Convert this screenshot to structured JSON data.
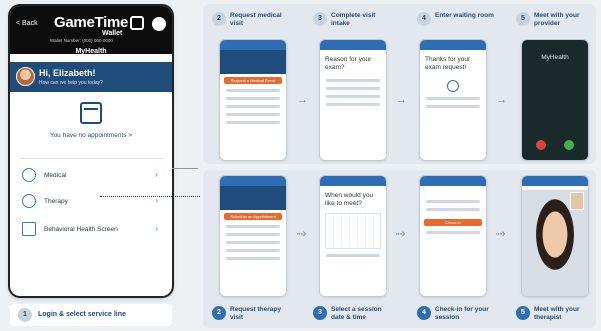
{
  "phone": {
    "back": "< Back",
    "brand": "GameTime",
    "wallet": "Wallet",
    "member": "Wallet Number: (000) 000-0000",
    "section": "MyHealth",
    "greeting": "Hi, Elizabeth!",
    "prompt": "How can we help you today?",
    "appointments": "You have no appointments >",
    "services": [
      {
        "label": "Medical",
        "icon": "stethoscope-icon"
      },
      {
        "label": "Therapy",
        "icon": "therapy-icon"
      },
      {
        "label": "Behavioral Health Screen",
        "icon": "clipboard-icon"
      }
    ]
  },
  "login_step": {
    "num": "1",
    "text": "Login & select service line"
  },
  "top_steps": [
    {
      "num": "2",
      "text": "Request medical visit"
    },
    {
      "num": "3",
      "text": "Complete visit intake"
    },
    {
      "num": "4",
      "text": "Enter waiting room"
    },
    {
      "num": "5",
      "text": "Meet with your provider"
    }
  ],
  "bottom_steps": [
    {
      "num": "2",
      "text": "Request therapy visit"
    },
    {
      "num": "3",
      "text": "Select a session date & time"
    },
    {
      "num": "4",
      "text": "Check-in for your session"
    },
    {
      "num": "5",
      "text": "Meet with your therapist"
    }
  ],
  "screens": {
    "medical_btn": "Request a Medical Event",
    "intake_title": "Reason for your exam?",
    "waiting_title": "Thanks for your exam request!",
    "provider_label": "MyHealth",
    "therapy_btn": "Schedule an Appointment",
    "session_title": "When would you like to meet?",
    "checkin_btn": "Check in"
  },
  "colors": {
    "accent": "#2f6db5",
    "navy": "#1f4c7a",
    "orange": "#e86b2e"
  }
}
